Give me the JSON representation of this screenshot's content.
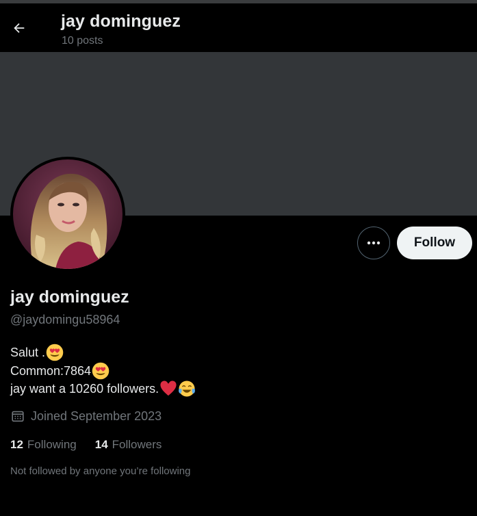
{
  "header": {
    "title": "jay dominguez",
    "posts_count": "10 posts",
    "back_icon": "arrow-left-icon"
  },
  "profile": {
    "display_name": "jay dominguez",
    "handle": "@jaydomingu58964",
    "bio": {
      "line1": "Salut .",
      "line2": "Common:7864",
      "line3": "jay want a 10260 followers. "
    },
    "joined": "Joined September 2023",
    "following_count": "12",
    "following_label": "Following",
    "followers_count": "14",
    "followers_label": "Followers",
    "not_followed": "Not followed by anyone you’re following"
  },
  "actions": {
    "more_icon": "more-dots-icon",
    "follow_label": "Follow"
  },
  "colors": {
    "background": "#000000",
    "banner": "#333639",
    "primary_text": "#e7e9ea",
    "secondary_text": "#71767b",
    "follow_button_bg": "#eff3f4",
    "heart": "#e0245e"
  }
}
